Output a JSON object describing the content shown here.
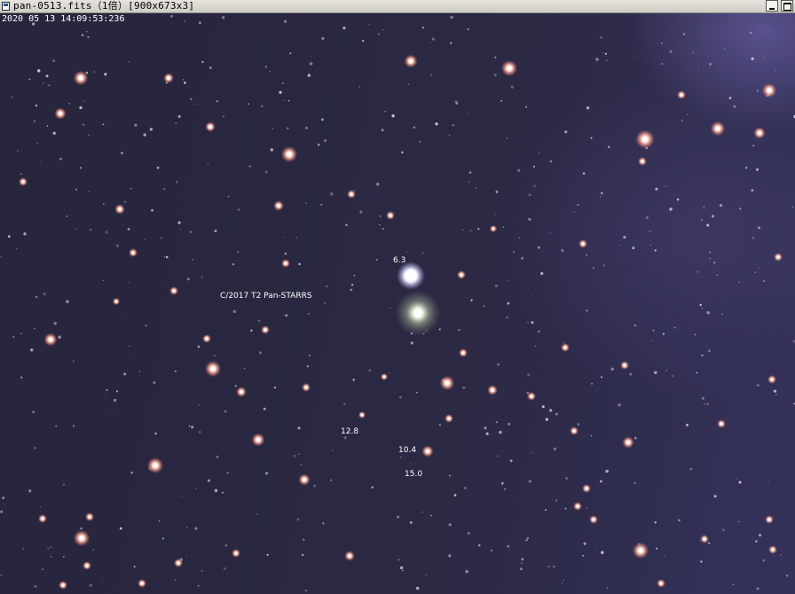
{
  "window": {
    "title": "pan-0513.fits（1倍）[900x673x3]",
    "minimize_icon": "minimize-icon",
    "maximize_icon": "maximize-icon",
    "app_icon": "fits-file-icon"
  },
  "image": {
    "timestamp": "2020 05 13 14:09:53:236",
    "labels": {
      "comet": "C/2017 T2 Pan-STARRS",
      "mag_bright": "6.3",
      "mag_a": "12.8",
      "mag_b": "10.4",
      "mag_c": "15.0"
    }
  },
  "colors": {
    "sky_dark": "#26253b",
    "sky_glow": "#7e6ebe",
    "star_warm": "#ffc4b0",
    "star_white": "#ffffff"
  }
}
